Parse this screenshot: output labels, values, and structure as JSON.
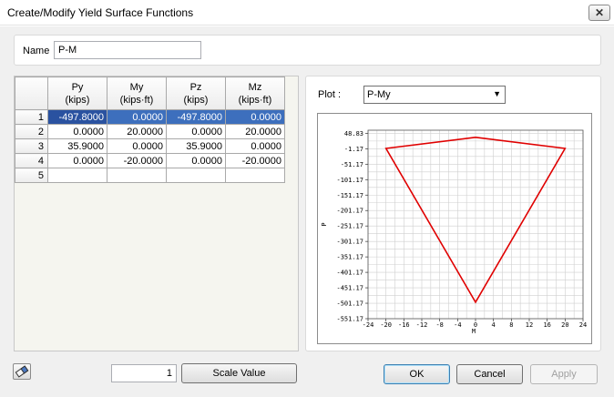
{
  "window": {
    "title": "Create/Modify Yield Surface Functions",
    "close_glyph": "✕"
  },
  "name_field": {
    "label": "Name",
    "value": "P-M"
  },
  "grid": {
    "headers": [
      {
        "line1": "Py",
        "line2": "(kips)"
      },
      {
        "line1": "My",
        "line2": "(kips·ft)"
      },
      {
        "line1": "Pz",
        "line2": "(kips)"
      },
      {
        "line1": "Mz",
        "line2": "(kips·ft)"
      }
    ],
    "rows": [
      {
        "num": "1",
        "cells": [
          "-497.8000",
          "0.0000",
          "-497.8000",
          "0.0000"
        ]
      },
      {
        "num": "2",
        "cells": [
          "0.0000",
          "20.0000",
          "0.0000",
          "20.0000"
        ]
      },
      {
        "num": "3",
        "cells": [
          "35.9000",
          "0.0000",
          "35.9000",
          "0.0000"
        ]
      },
      {
        "num": "4",
        "cells": [
          "0.0000",
          "-20.0000",
          "0.0000",
          "-20.0000"
        ]
      },
      {
        "num": "5",
        "cells": [
          "",
          "",
          "",
          ""
        ]
      }
    ]
  },
  "plot_selector": {
    "label": "Plot :",
    "selected": "P-My"
  },
  "chart_data": {
    "type": "line",
    "xlabel": "M",
    "ylabel": "P",
    "xlim": [
      -24,
      24
    ],
    "ylim": [
      -551.17,
      58.83
    ],
    "x_ticks": [
      "-24",
      "-20",
      "-16",
      "-12",
      "-8",
      "-4",
      "0",
      "4",
      "8",
      "12",
      "16",
      "20",
      "24"
    ],
    "y_ticks": [
      "48.83",
      "-1.17",
      "-51.17",
      "-101.17",
      "-151.17",
      "-201.17",
      "-251.17",
      "-301.17",
      "-351.17",
      "-401.17",
      "-451.17",
      "-501.17",
      "-551.17"
    ],
    "grid": true,
    "line_color": "#e00000",
    "points": [
      [
        0,
        35.9
      ],
      [
        20,
        0
      ],
      [
        0,
        -497.8
      ],
      [
        -20,
        0
      ],
      [
        0,
        35.9
      ]
    ]
  },
  "footer": {
    "scale_value": "1",
    "scale_button": "Scale Value",
    "ok": "OK",
    "cancel": "Cancel",
    "apply": "Apply"
  }
}
